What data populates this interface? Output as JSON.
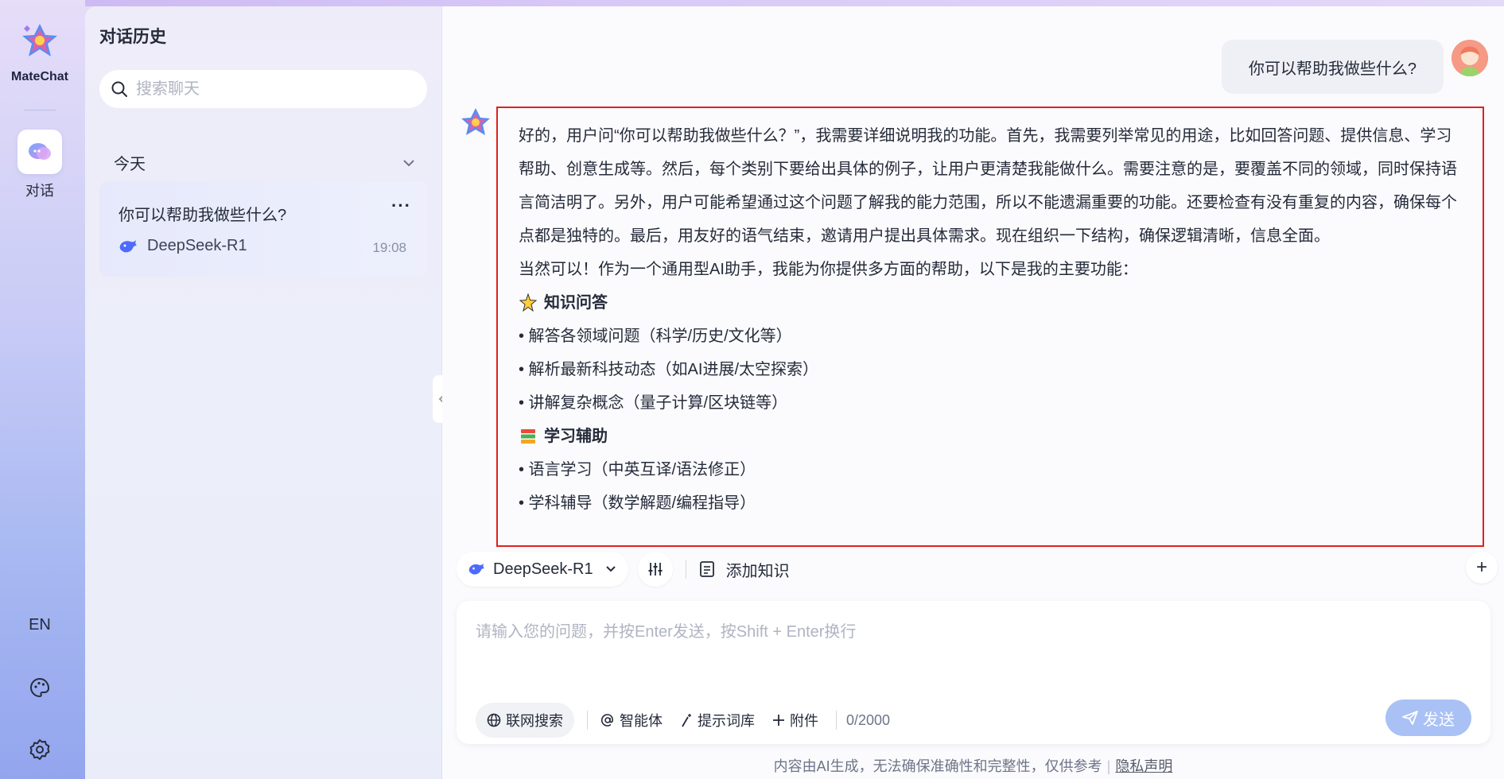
{
  "app": {
    "brand": "MateChat"
  },
  "rail": {
    "chat_label": "对话",
    "lang_label": "EN"
  },
  "history": {
    "title": "对话历史",
    "search_placeholder": "搜索聊天",
    "group_label": "今天",
    "items": [
      {
        "title": "你可以帮助我做些什么?",
        "model": "DeepSeek-R1",
        "time": "19:08",
        "more": "···"
      }
    ]
  },
  "chat": {
    "user_message": "你可以帮助我做些什么?",
    "ai_thinking": "好的，用户问“你可以帮助我做些什么？”，我需要详细说明我的功能。首先，我需要列举常见的用途，比如回答问题、提供信息、学习帮助、创意生成等。然后，每个类别下要给出具体的例子，让用户更清楚我能做什么。需要注意的是，要覆盖不同的领域，同时保持语言简洁明了。另外，用户可能希望通过这个问题了解我的能力范围，所以不能遗漏重要的功能。还要检查有没有重复的内容，确保每个点都是独特的。最后，用友好的语气结束，邀请用户提出具体需求。现在组织一下结构，确保逻辑清晰，信息全面。",
    "ai_intro": "当然可以！作为一个通用型AI助手，我能为你提供多方面的帮助，以下是我的主要功能：",
    "sections": [
      {
        "heading": "知识问答",
        "bullets": [
          "• 解答各领域问题（科学/历史/文化等）",
          "• 解析最新科技动态（如AI进展/太空探索）",
          "• 讲解复杂概念（量子计算/区块链等）"
        ]
      },
      {
        "heading": "学习辅助",
        "bullets": [
          "• 语言学习（中英互译/语法修正）",
          "• 学科辅导（数学解题/编程指导）"
        ]
      }
    ]
  },
  "toolbar": {
    "model_name": "DeepSeek-R1",
    "knowledge_label": "添加知识",
    "plus": "+"
  },
  "composer": {
    "placeholder": "请输入您的问题，并按Enter发送，按Shift + Enter换行",
    "web_search": "联网搜索",
    "agent": "智能体",
    "prompt_lib": "提示词库",
    "attachment": "附件",
    "counter": "0/2000",
    "send": "发送"
  },
  "footer": {
    "disclaimer": "内容由AI生成，无法确保准确性和完整性，仅供参考",
    "privacy": "隐私声明"
  },
  "colors": {
    "accent": "#5e7ce0",
    "highlight_border": "#e02020",
    "send_bg": "#a9c1f5"
  }
}
